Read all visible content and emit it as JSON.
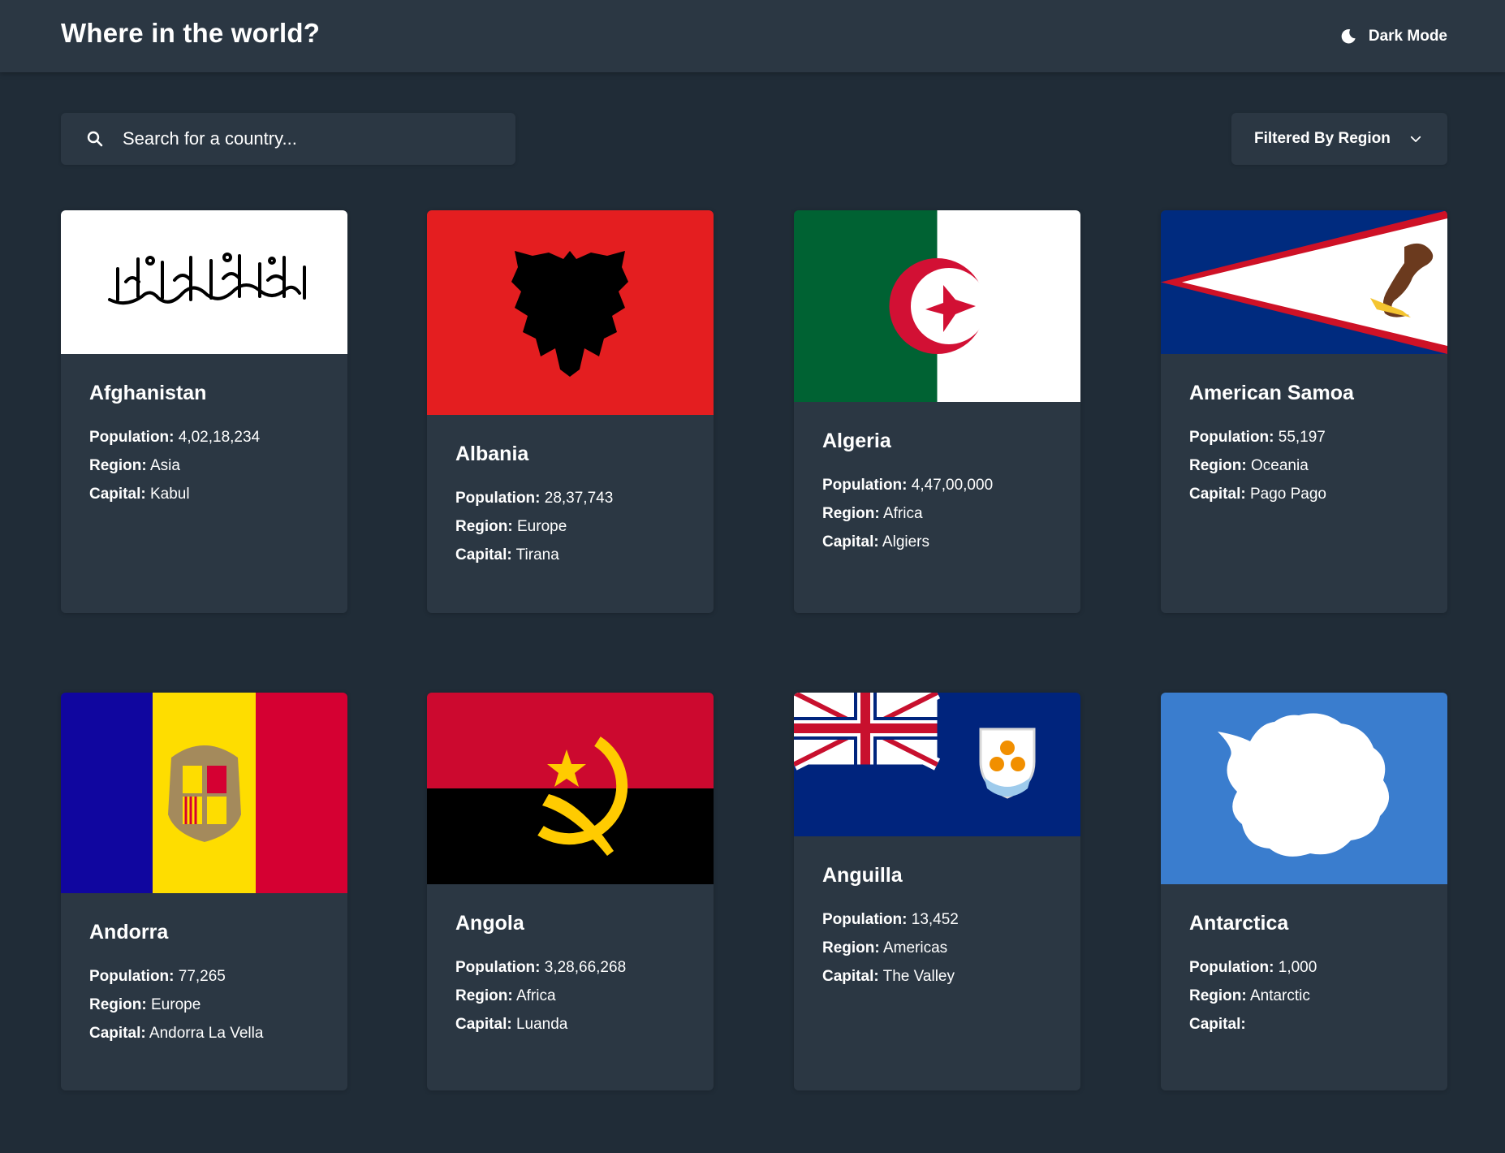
{
  "header": {
    "title": "Where in the world?",
    "theme_label": "Dark Mode"
  },
  "search": {
    "placeholder": "Search for a country..."
  },
  "filter": {
    "label": "Filtered By Region"
  },
  "labels": {
    "population": "Population:",
    "region": "Region:",
    "capital": "Capital:"
  },
  "countries": [
    {
      "name": "Afghanistan",
      "population": "4,02,18,234",
      "region": "Asia",
      "capital": "Kabul"
    },
    {
      "name": "Albania",
      "population": "28,37,743",
      "region": "Europe",
      "capital": "Tirana"
    },
    {
      "name": "Algeria",
      "population": "4,47,00,000",
      "region": "Africa",
      "capital": "Algiers"
    },
    {
      "name": "American Samoa",
      "population": "55,197",
      "region": "Oceania",
      "capital": "Pago Pago"
    },
    {
      "name": "Andorra",
      "population": "77,265",
      "region": "Europe",
      "capital": "Andorra La Vella"
    },
    {
      "name": "Angola",
      "population": "3,28,66,268",
      "region": "Africa",
      "capital": "Luanda"
    },
    {
      "name": "Anguilla",
      "population": "13,452",
      "region": "Americas",
      "capital": "The Valley"
    },
    {
      "name": "Antarctica",
      "population": "1,000",
      "region": "Antarctic",
      "capital": ""
    }
  ],
  "colors": {
    "background": "#202c37",
    "element": "#2b3743",
    "text": "#ffffff"
  },
  "flag_images": [
    "afghanistan-flag",
    "albania-flag",
    "algeria-flag",
    "american-samoa-flag",
    "andorra-flag",
    "angola-flag",
    "anguilla-flag",
    "antarctica-flag"
  ]
}
